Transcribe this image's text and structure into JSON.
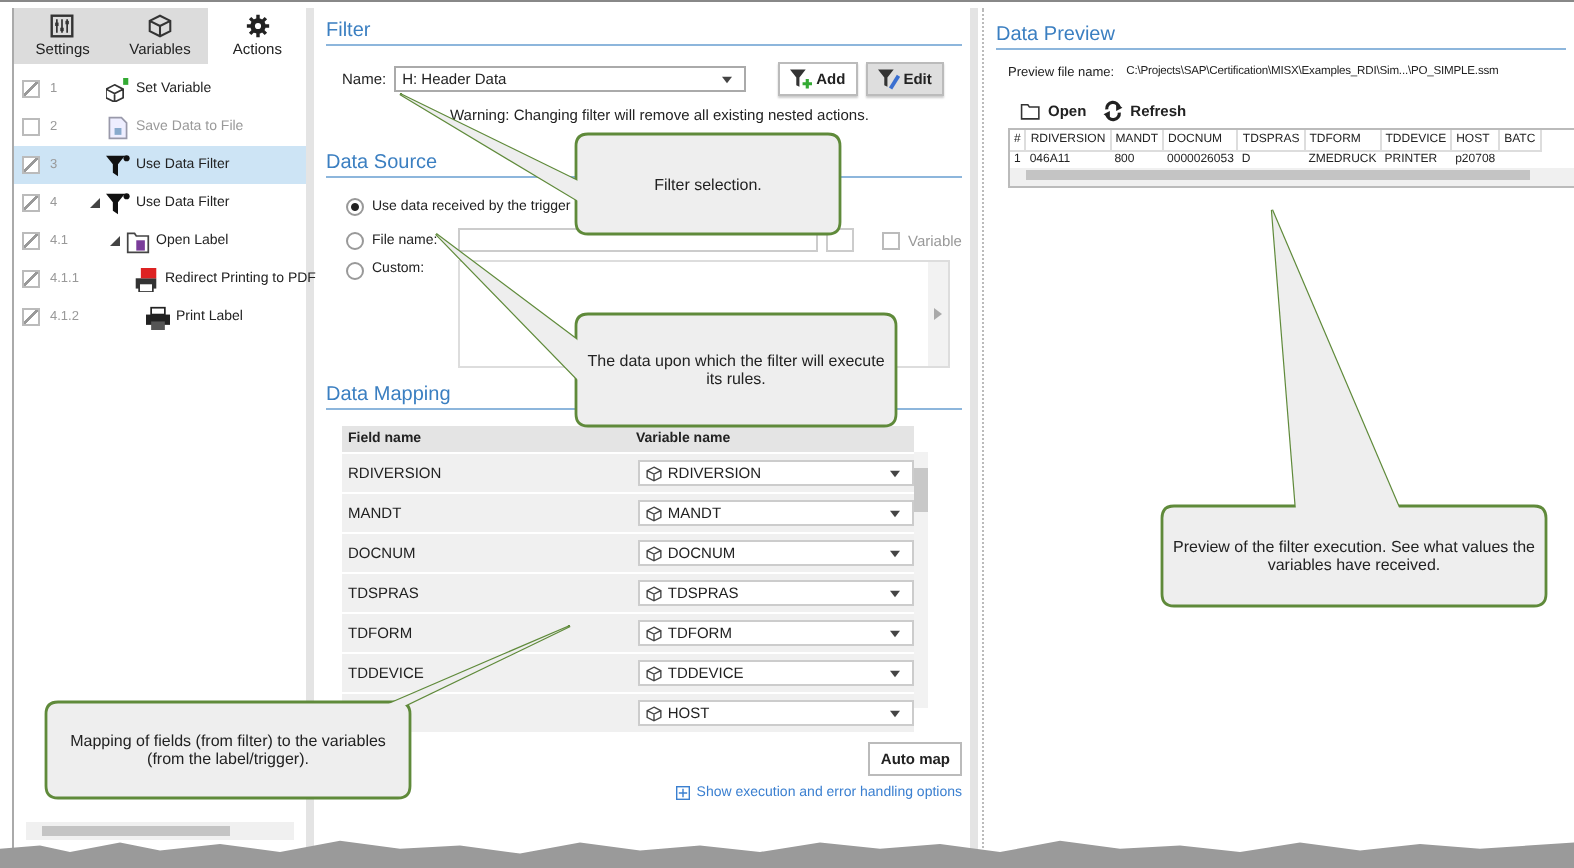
{
  "tabs": [
    {
      "label": "Settings",
      "kind": "settings",
      "selected": false
    },
    {
      "label": "Variables",
      "kind": "variables",
      "selected": false
    },
    {
      "label": "Actions",
      "kind": "actions",
      "selected": true
    }
  ],
  "actions": [
    {
      "number": "1",
      "label": "Set Variable",
      "kind": "variable",
      "checked": true,
      "disabled": false,
      "selected": false
    },
    {
      "number": "2",
      "label": "Save Data to File",
      "kind": "file",
      "checked": false,
      "disabled": true,
      "selected": false
    },
    {
      "number": "3",
      "label": "Use Data Filter",
      "kind": "filter",
      "checked": true,
      "disabled": false,
      "selected": true
    },
    {
      "number": "4",
      "label": "Use Data Filter",
      "kind": "filter",
      "checked": true,
      "disabled": false,
      "selected": false,
      "expanded": true,
      "children": [
        {
          "number": "4.1",
          "label": "Open Label",
          "kind": "label",
          "checked": true,
          "disabled": false,
          "selected": false,
          "expanded": true,
          "children": [
            {
              "number": "4.1.1",
              "label": "Redirect Printing to PDF",
              "kind": "pdf",
              "checked": true,
              "disabled": false,
              "selected": false
            },
            {
              "number": "4.1.2",
              "label": "Print Label",
              "kind": "print",
              "checked": true,
              "disabled": false,
              "selected": false
            }
          ]
        }
      ]
    }
  ],
  "filter": {
    "heading": "Filter",
    "name_label": "Name:",
    "value": "H: Header Data",
    "buttons": [
      {
        "label": "Add",
        "kind": "add",
        "pressed": false
      },
      {
        "label": "Edit",
        "kind": "edit",
        "pressed": true
      }
    ],
    "warning": "Warning: Changing filter will remove all existing nested actions."
  },
  "data_source": {
    "heading": "Data Source",
    "options": [
      {
        "label": "Use data received by the trigger",
        "kind": "trigger",
        "selected": true
      },
      {
        "label": "File name:",
        "kind": "file",
        "selected": false
      },
      {
        "label": "Custom:",
        "kind": "custom",
        "selected": false
      }
    ],
    "variable_checkbox": {
      "label": "Variable",
      "checked": false,
      "disabled": true
    }
  },
  "data_mapping": {
    "heading": "Data Mapping",
    "columns": [
      "Field name",
      "Variable name"
    ],
    "rows": [
      {
        "field": "RDIVERSION",
        "variable": "RDIVERSION"
      },
      {
        "field": "MANDT",
        "variable": "MANDT"
      },
      {
        "field": "DOCNUM",
        "variable": "DOCNUM"
      },
      {
        "field": "TDSPRAS",
        "variable": "TDSPRAS"
      },
      {
        "field": "TDFORM",
        "variable": "TDFORM"
      },
      {
        "field": "TDDEVICE",
        "variable": "TDDEVICE"
      },
      {
        "variable": "HOST"
      }
    ],
    "auto_map": "Auto map",
    "options_link": "Show execution and error handling options"
  },
  "data_preview": {
    "heading": "Data Preview",
    "file_label": "Preview file name:",
    "file_path": "C:\\Projects\\SAP\\Certification\\MISX\\Examples_RDI\\Sim...\\PO_SIMPLE.ssm",
    "toolbar": [
      {
        "label": "Open",
        "kind": "open"
      },
      {
        "label": "Refresh",
        "kind": "refresh"
      }
    ],
    "columns": [
      "#",
      "RDIVERSION",
      "MANDT",
      "DOCNUM",
      "TDSPRAS",
      "TDFORM",
      "TDDEVICE",
      "HOST",
      "BATC"
    ],
    "rows": [
      [
        "1",
        "046A11",
        "800",
        "0000026053",
        "D",
        "ZMEDRUCK",
        "PRINTER",
        "p20708"
      ]
    ]
  },
  "callouts": [
    "Filter selection.",
    "The data upon which the filter will execute its rules.",
    "Mapping of fields (from filter) to the variables (from the label/trigger).",
    "Preview of the filter execution. See what values the variables have received."
  ]
}
